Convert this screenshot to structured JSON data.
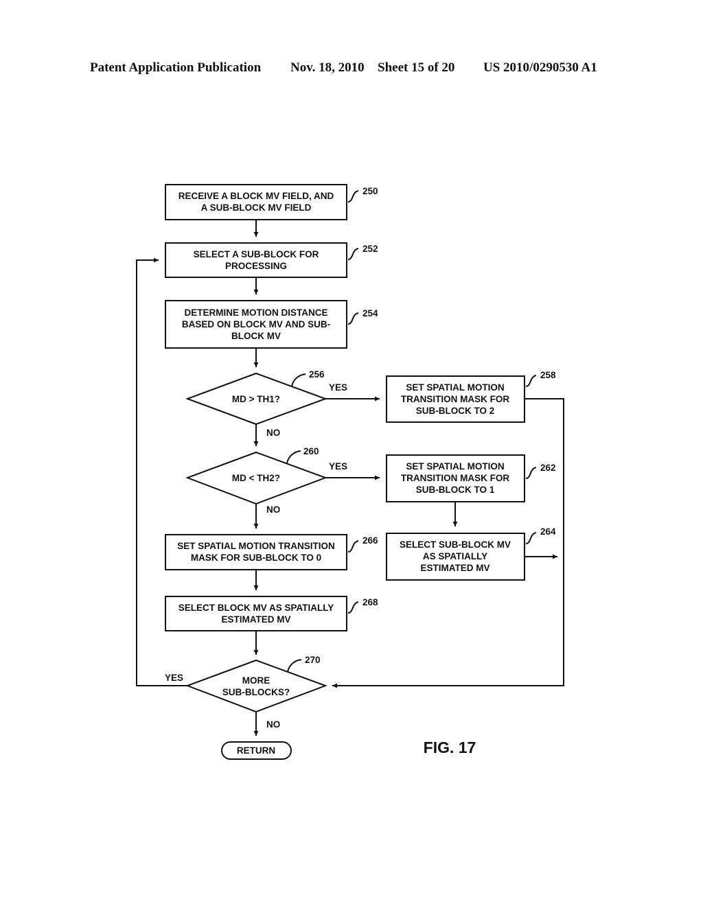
{
  "header": {
    "publication": "Patent Application Publication",
    "date": "Nov. 18, 2010",
    "sheet": "Sheet 15 of 20",
    "number": "US 2010/0290530 A1"
  },
  "figure_label": "FIG. 17",
  "nodes": {
    "n250": {
      "ref": "250",
      "lines": [
        "RECEIVE A BLOCK MV FIELD, AND",
        "A SUB-BLOCK MV FIELD"
      ]
    },
    "n252": {
      "ref": "252",
      "lines": [
        "SELECT A SUB-BLOCK FOR",
        "PROCESSING"
      ]
    },
    "n254": {
      "ref": "254",
      "lines": [
        "DETERMINE MOTION DISTANCE",
        "BASED ON BLOCK MV AND SUB-",
        "BLOCK MV"
      ]
    },
    "n256": {
      "ref": "256",
      "lines": [
        "MD > TH1?"
      ]
    },
    "n258": {
      "ref": "258",
      "lines": [
        "SET SPATIAL MOTION",
        "TRANSITION MASK FOR",
        "SUB-BLOCK TO 2"
      ]
    },
    "n260": {
      "ref": "260",
      "lines": [
        "MD < TH2?"
      ]
    },
    "n262": {
      "ref": "262",
      "lines": [
        "SET SPATIAL MOTION",
        "TRANSITION MASK FOR",
        "SUB-BLOCK TO 1"
      ]
    },
    "n264": {
      "ref": "264",
      "lines": [
        "SELECT SUB-BLOCK MV",
        "AS SPATIALLY",
        "ESTIMATED MV"
      ]
    },
    "n266": {
      "ref": "266",
      "lines": [
        "SET SPATIAL MOTION TRANSITION",
        "MASK FOR SUB-BLOCK TO 0"
      ]
    },
    "n268": {
      "ref": "268",
      "lines": [
        "SELECT BLOCK MV AS SPATIALLY",
        "ESTIMATED MV"
      ]
    },
    "n270": {
      "ref": "270",
      "lines": [
        "MORE",
        "SUB-BLOCKS?"
      ]
    },
    "return": {
      "lines": [
        "RETURN"
      ]
    }
  },
  "edge_labels": {
    "yes": "YES",
    "no": "NO"
  }
}
